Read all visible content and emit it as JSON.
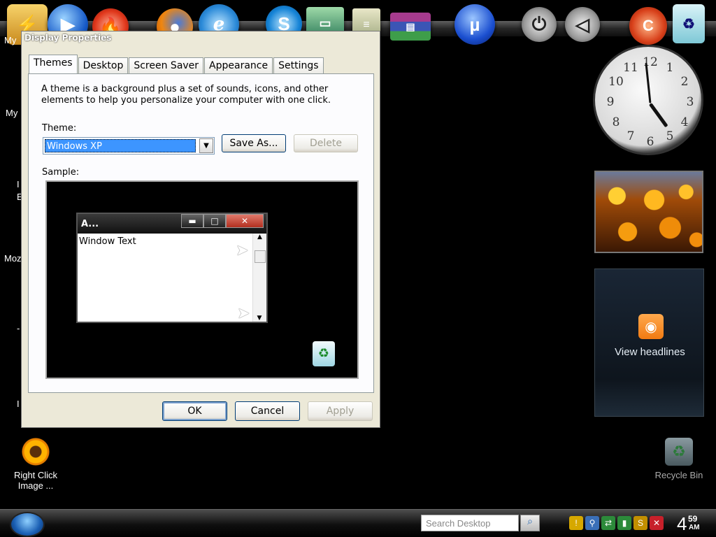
{
  "dialog": {
    "title": "Display Properties",
    "tabs": [
      "Themes",
      "Desktop",
      "Screen Saver",
      "Appearance",
      "Settings"
    ],
    "active_tab": "Themes",
    "description": "A theme is a background plus a set of sounds, icons, and other elements to help you personalize your computer with one click.",
    "theme_label": "Theme:",
    "theme_value": "Windows XP",
    "save_as_label": "Save As...",
    "delete_label": "Delete",
    "sample_label": "Sample:",
    "sample_window_title": "A...",
    "sample_window_text": "Window Text",
    "ok_label": "OK",
    "cancel_label": "Cancel",
    "apply_label": "Apply"
  },
  "dock": {
    "icons": [
      "winamp-icon",
      "media-player-icon",
      "burner-icon",
      "firefox-icon",
      "internet-explorer-icon",
      "skype-icon",
      "monitor-icon",
      "notepad-icon",
      "winrar-icon",
      "utorrent-icon",
      "power-icon",
      "back-icon",
      "ccleaner-icon",
      "trash-icon"
    ]
  },
  "left_labels": [
    "My",
    "My",
    "I",
    "E",
    "Moz",
    "-",
    "I"
  ],
  "desktop": {
    "right_click_label": "Right Click Image ...",
    "recycle_bin_label": "Recycle Bin"
  },
  "gadgets": {
    "clock_numbers": [
      "12",
      "1",
      "2",
      "3",
      "4",
      "5",
      "6",
      "7",
      "8",
      "9",
      "10",
      "11"
    ],
    "headlines_label": "View headlines"
  },
  "taskbar": {
    "search_placeholder": "Search Desktop",
    "time_hour": "4",
    "time_minute": "59",
    "time_ampm": "AM"
  },
  "colors": {
    "selection": "#3d95ff",
    "dialog_bg": "#ece9d8",
    "rss": "#f17a12"
  }
}
